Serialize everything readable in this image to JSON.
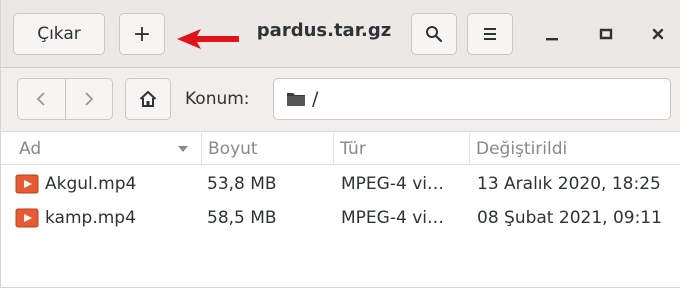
{
  "header": {
    "eject_label": "Çıkar",
    "add_label": "+",
    "title": "pardus.tar.gz"
  },
  "location": {
    "label": "Konum:",
    "path": "/"
  },
  "columns": {
    "name": "Ad",
    "size": "Boyut",
    "type": "Tür",
    "modified": "Değiştirildi"
  },
  "files": [
    {
      "name": "Akgul.mp4",
      "size": "53,8 MB",
      "type": "MPEG-4 vi…",
      "modified": "13 Aralık 2020, 18:25"
    },
    {
      "name": "kamp.mp4",
      "size": "58,5 MB",
      "type": "MPEG-4 vi…",
      "modified": "08 Şubat 2021, 09:11"
    }
  ],
  "icons": {
    "search": "search-icon",
    "menu": "hamburger-menu-icon",
    "minimize": "minimize-icon",
    "maximize": "maximize-icon",
    "close": "close-icon",
    "back": "chevron-left-icon",
    "forward": "chevron-right-icon",
    "home": "home-icon",
    "folder": "folder-icon",
    "video": "video-file-icon",
    "annotation_arrow": "red-arrow-icon"
  },
  "colors": {
    "annotation_arrow": "#e0131b",
    "video_icon": "#e45b34"
  }
}
